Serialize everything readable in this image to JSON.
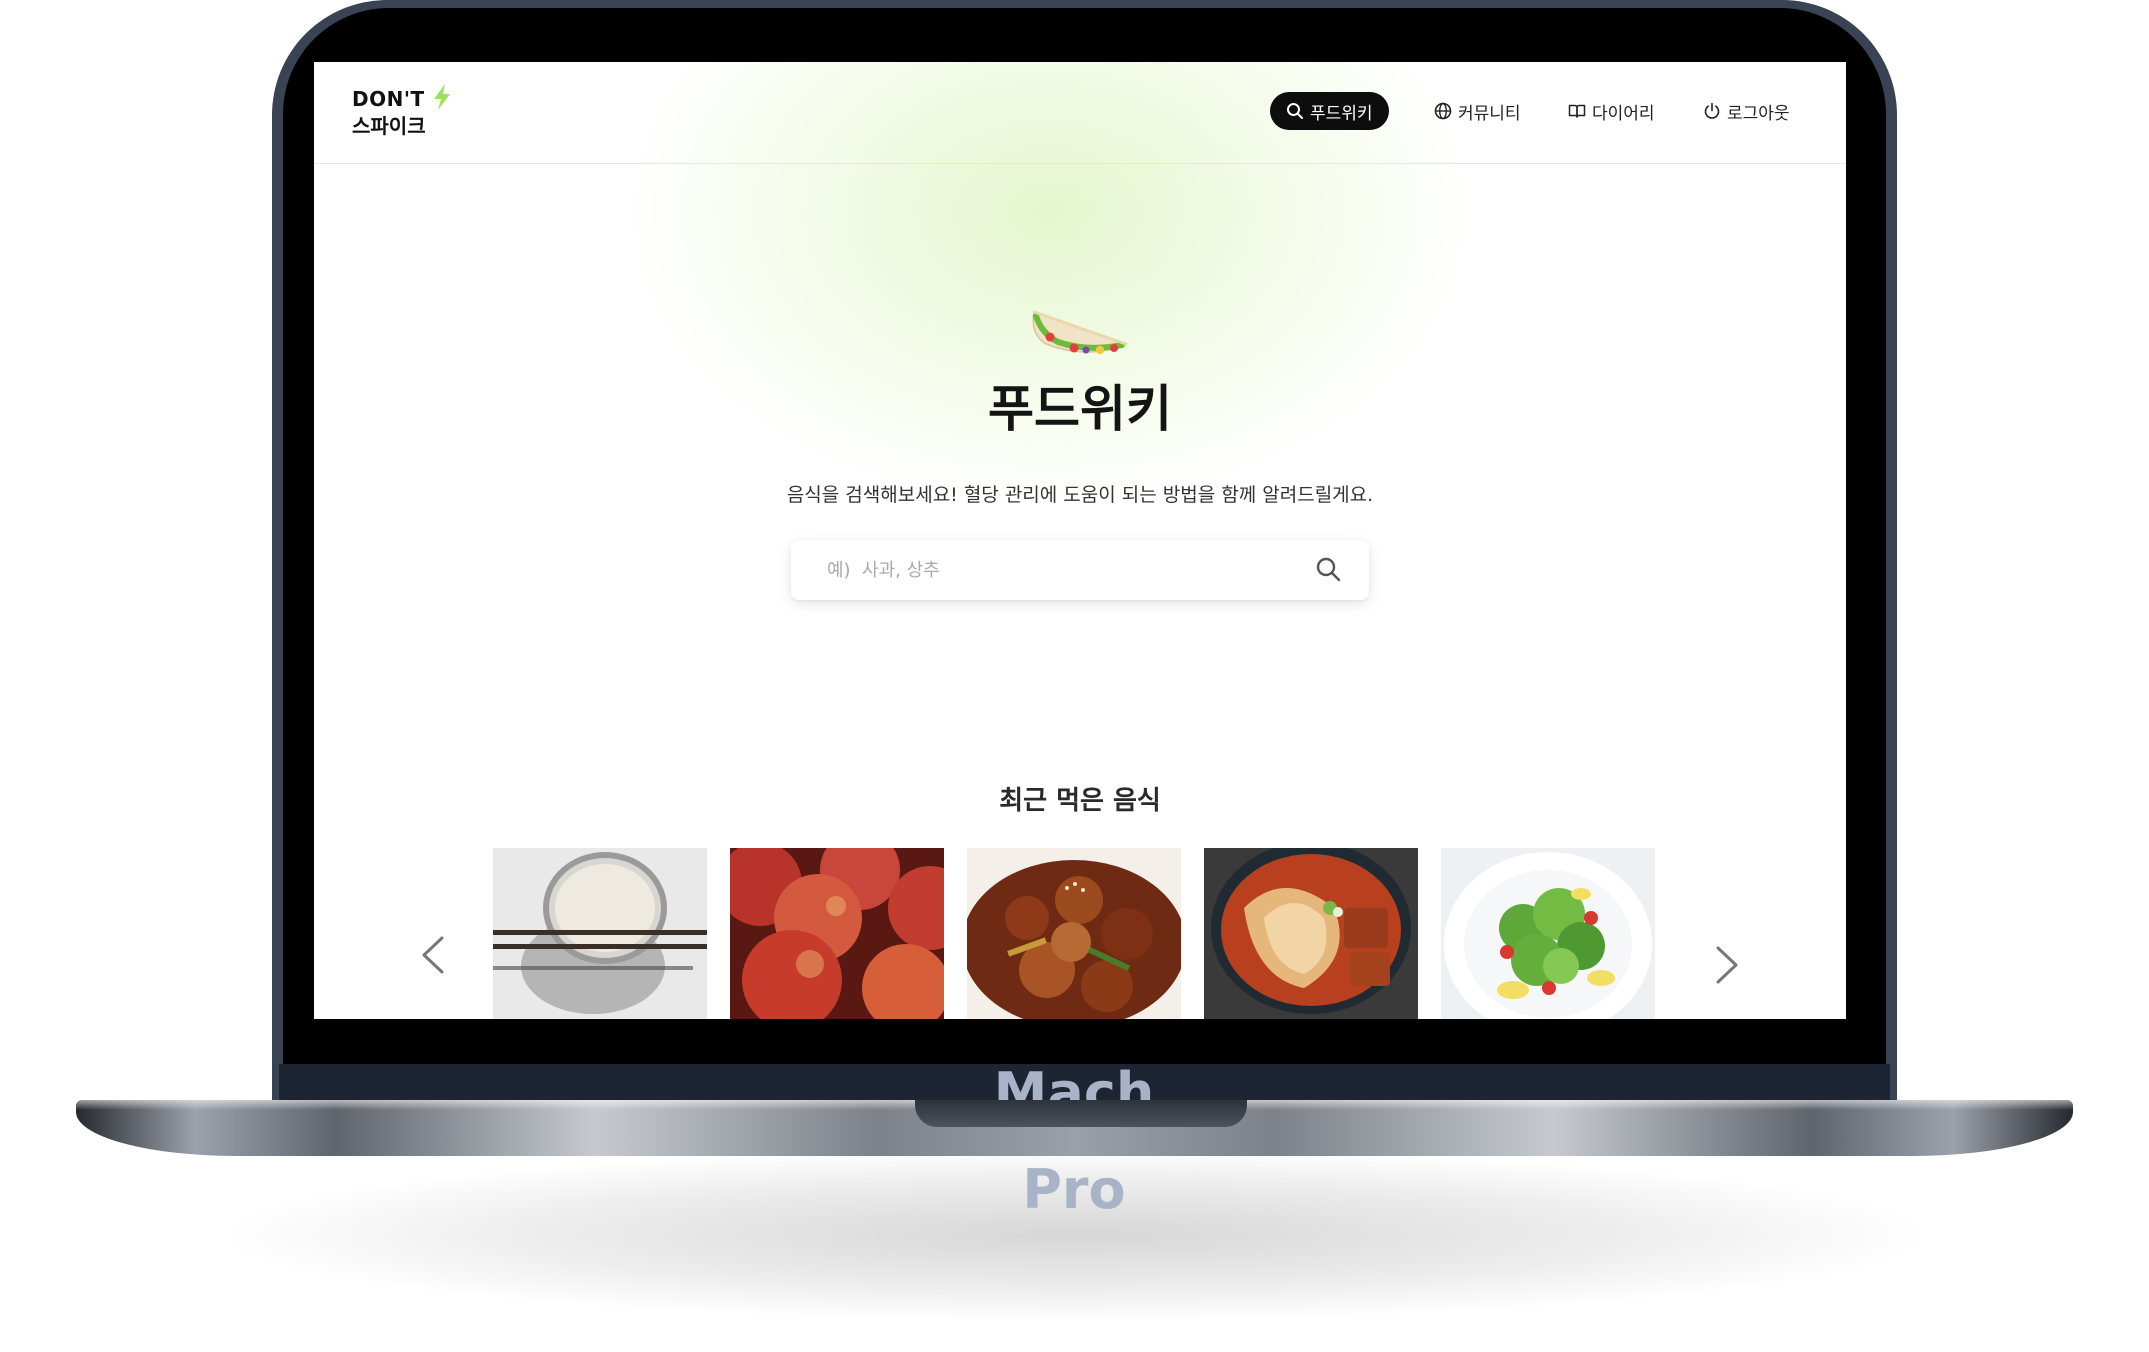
{
  "device": {
    "model_line1": "Mach",
    "model_line2": "Pro"
  },
  "header": {
    "logo_line1": "DON'T",
    "logo_line2": "스파이크"
  },
  "nav": {
    "items": [
      {
        "label": "푸드위키",
        "icon": "search-icon",
        "active": true
      },
      {
        "label": "커뮤니티",
        "icon": "globe-icon",
        "active": false
      },
      {
        "label": "다이어리",
        "icon": "book-icon",
        "active": false
      },
      {
        "label": "로그아웃",
        "icon": "power-icon",
        "active": false
      }
    ]
  },
  "hero": {
    "title": "푸드위키",
    "subtitle": "음식을 검색해보세요! 혈당 관리에 도움이 되는 방법을 함께 알려드릴게요.",
    "search_placeholder": "예)  사과, 상추",
    "search_value": ""
  },
  "recent": {
    "title": "최근 먹은 음식",
    "foods": [
      {
        "icon": "rice-bowl-with-chopsticks-photo"
      },
      {
        "icon": "apples-photo"
      },
      {
        "icon": "braised-chicken-photo"
      },
      {
        "icon": "kimchi-stew-photo"
      },
      {
        "icon": "green-salad-photo"
      }
    ]
  },
  "colors": {
    "accent_green": "#9be15d",
    "nav_active_bg": "#0d0d0d",
    "device_frame": "#3a4354"
  }
}
